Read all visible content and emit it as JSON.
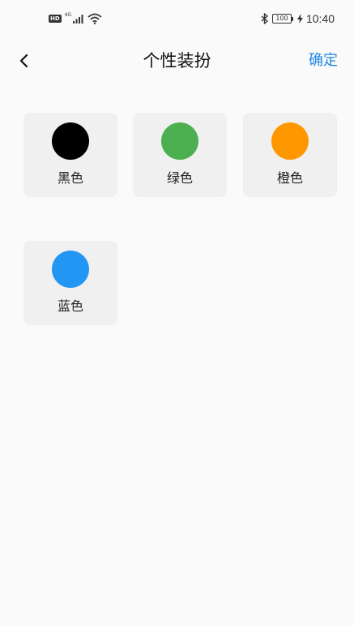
{
  "status_bar": {
    "hd_badge": "HD",
    "network_label": "4G",
    "battery": "100",
    "time": "10:40",
    "icons": [
      "hd-icon",
      "signal-icon",
      "wifi-icon",
      "bluetooth-icon",
      "battery-icon",
      "charging-icon"
    ]
  },
  "header": {
    "back_icon": "chevron-left-icon",
    "title": "个性装扮",
    "confirm_label": "确定",
    "confirm_color": "#1e88e5"
  },
  "themes": [
    {
      "label": "黑色",
      "color": "#000000"
    },
    {
      "label": "绿色",
      "color": "#4caf50"
    },
    {
      "label": "橙色",
      "color": "#ff9800"
    },
    {
      "label": "蓝色",
      "color": "#2196f3"
    }
  ]
}
